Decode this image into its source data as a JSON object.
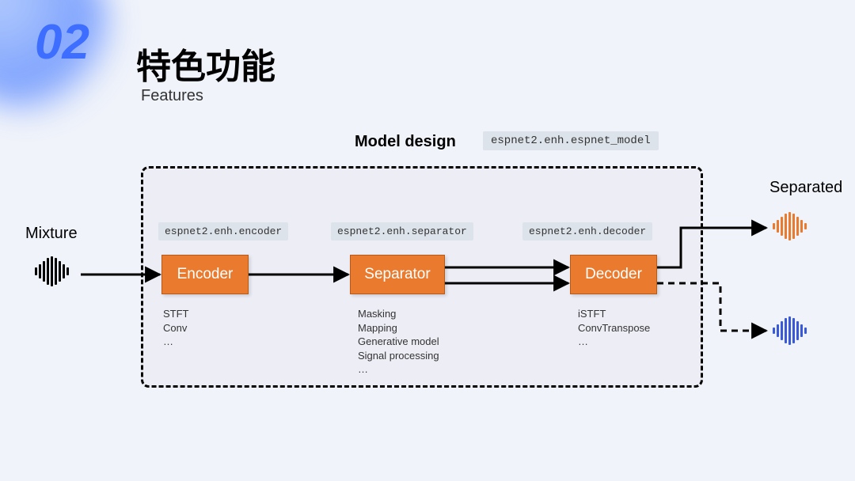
{
  "section_number": "02",
  "title_cn": "特色功能",
  "title_en": "Features",
  "model_design_label": "Model design",
  "model_design_code": "espnet2.enh.espnet_model",
  "mixture_label": "Mixture",
  "separated_label": "Separated",
  "blocks": {
    "encoder": {
      "label": "Encoder",
      "module": "espnet2.enh.encoder",
      "subtext": "STFT\nConv\n…"
    },
    "separator": {
      "label": "Separator",
      "module": "espnet2.enh.separator",
      "subtext": "Masking\nMapping\nGenerative model\nSignal processing\n…"
    },
    "decoder": {
      "label": "Decoder",
      "module": "espnet2.enh.decoder",
      "subtext": "iSTFT\nConvTranspose\n…"
    }
  }
}
